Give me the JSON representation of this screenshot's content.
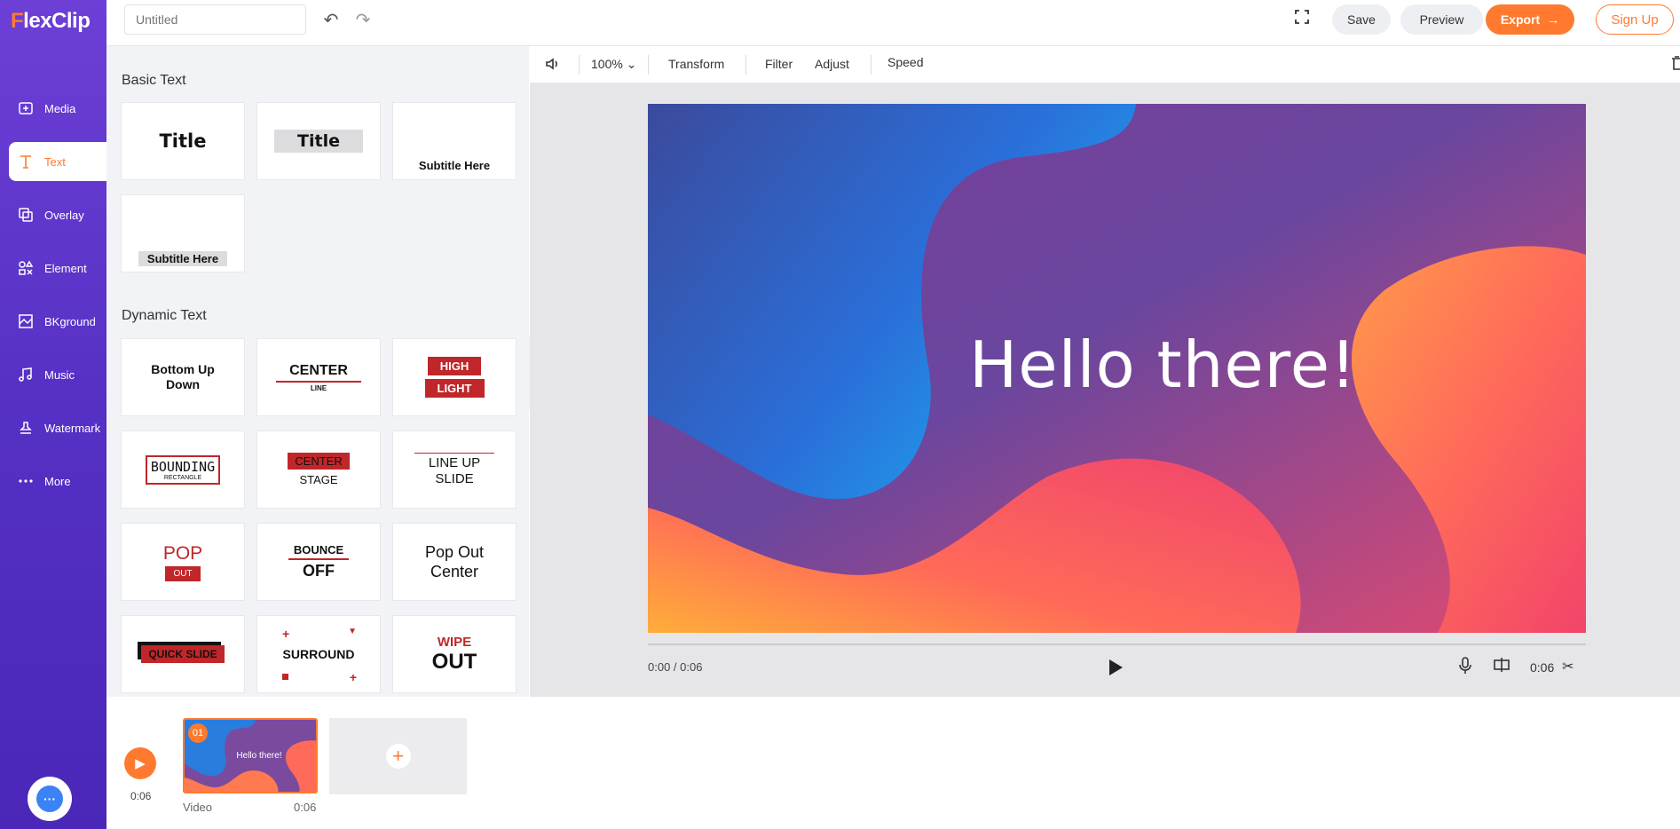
{
  "app": {
    "logo": "FlexClip",
    "logo_first": "F",
    "logo_rest": "lexClip"
  },
  "sidebar": {
    "items": [
      {
        "label": "Media",
        "icon": "media-icon"
      },
      {
        "label": "Text",
        "icon": "text-icon"
      },
      {
        "label": "Overlay",
        "icon": "overlay-icon"
      },
      {
        "label": "Element",
        "icon": "element-icon"
      },
      {
        "label": "BKground",
        "icon": "background-icon"
      },
      {
        "label": "Music",
        "icon": "music-icon"
      },
      {
        "label": "Watermark",
        "icon": "watermark-icon"
      },
      {
        "label": "More",
        "icon": "more-icon"
      }
    ],
    "active": "Text"
  },
  "topbar": {
    "title_placeholder": "Untitled",
    "save_label": "Save",
    "preview_label": "Preview",
    "export_label": "Export",
    "signup_label": "Sign Up"
  },
  "panel": {
    "basic_title": "Basic Text",
    "basic": [
      {
        "text": "Title"
      },
      {
        "text": "Title"
      },
      {
        "text": "Subtitle Here"
      },
      {
        "text": "Subtitle Here"
      }
    ],
    "dynamic_title": "Dynamic Text",
    "dynamic": [
      {
        "line1": "Bottom Up",
        "line2": "Down"
      },
      {
        "line1": "CENTER",
        "line2": "LINE"
      },
      {
        "line1": "HIGH",
        "line2": "LIGHT"
      },
      {
        "line1": "BOUNDING",
        "line2": "RECTANGLE"
      },
      {
        "line1": "CENTER",
        "line2": "STAGE"
      },
      {
        "line1": "LINE UP",
        "line2": "SLIDE"
      },
      {
        "line1": "POP",
        "line2": "OUT"
      },
      {
        "line1": "BOUNCE",
        "line2": "OFF"
      },
      {
        "line1": "Pop Out",
        "line2": "Center"
      },
      {
        "line1": "QUICK SLIDE"
      },
      {
        "line1": "SURROUND"
      },
      {
        "line1": "WIPE",
        "line2": "OUT"
      }
    ]
  },
  "toolbar": {
    "zoom": "100%",
    "transform": "Transform",
    "filter": "Filter",
    "adjust": "Adjust",
    "speed": "Speed"
  },
  "canvas": {
    "text": "Hello there!"
  },
  "player": {
    "time": "0:00 / 0:06",
    "duration": "0:06"
  },
  "timeline": {
    "total_time": "0:06",
    "clip": {
      "number": "01",
      "label": "Video",
      "duration": "0:06",
      "thumb_text": "Hello there!"
    }
  },
  "colors": {
    "accent": "#ff7a2f",
    "sidebar": "#5a34c8",
    "highlight_red": "#c0262a"
  }
}
